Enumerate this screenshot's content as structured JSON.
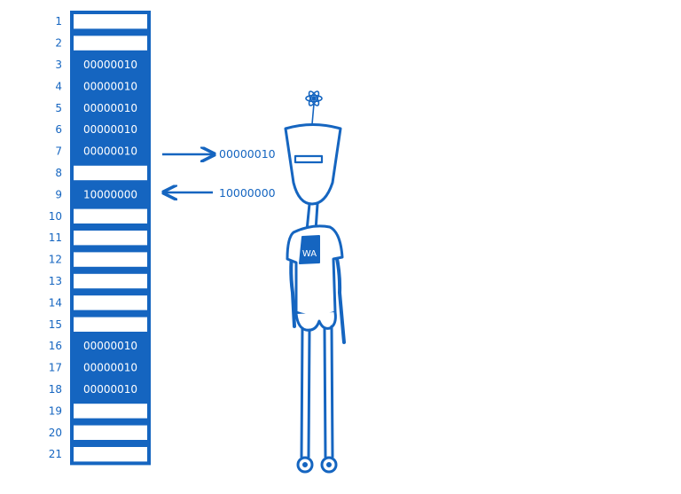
{
  "colors": {
    "accent": "#1565c0",
    "background": "#ffffff"
  },
  "memory": {
    "cells": [
      {
        "index": "1",
        "value": ""
      },
      {
        "index": "2",
        "value": ""
      },
      {
        "index": "3",
        "value": "00000010"
      },
      {
        "index": "4",
        "value": "00000010"
      },
      {
        "index": "5",
        "value": "00000010"
      },
      {
        "index": "6",
        "value": "00000010"
      },
      {
        "index": "7",
        "value": "00000010"
      },
      {
        "index": "8",
        "value": ""
      },
      {
        "index": "9",
        "value": "10000000"
      },
      {
        "index": "10",
        "value": ""
      },
      {
        "index": "11",
        "value": ""
      },
      {
        "index": "12",
        "value": ""
      },
      {
        "index": "13",
        "value": ""
      },
      {
        "index": "14",
        "value": ""
      },
      {
        "index": "15",
        "value": ""
      },
      {
        "index": "16",
        "value": "00000010"
      },
      {
        "index": "17",
        "value": "00000010"
      },
      {
        "index": "18",
        "value": "00000010"
      },
      {
        "index": "19",
        "value": ""
      },
      {
        "index": "20",
        "value": ""
      },
      {
        "index": "21",
        "value": ""
      }
    ]
  },
  "transfers": {
    "read": {
      "value": "00000010"
    },
    "write": {
      "value": "10000000"
    }
  },
  "character": {
    "shirt_label": "WA"
  }
}
